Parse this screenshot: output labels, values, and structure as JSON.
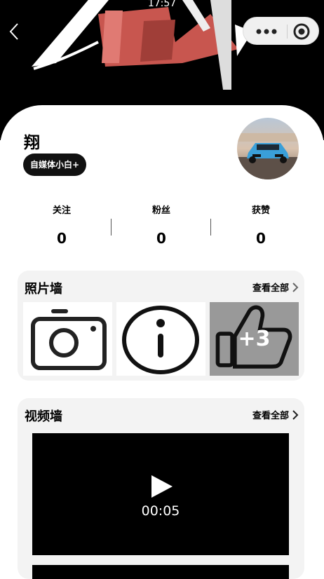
{
  "status_bar": {
    "time": "17:57"
  },
  "nav": {
    "back_icon": "chevron-left-icon",
    "more_icon": "more-dots-icon",
    "close_icon": "target-circle-icon"
  },
  "profile": {
    "name": "翔",
    "tag": "自媒体小白+"
  },
  "stats": [
    {
      "label": "关注",
      "value": "0"
    },
    {
      "label": "粉丝",
      "value": "0"
    },
    {
      "label": "获赞",
      "value": "0"
    }
  ],
  "photo_wall": {
    "title": "照片墙",
    "view_all": "查看全部",
    "items": [
      {
        "icon": "camera-icon"
      },
      {
        "icon": "info-icon"
      },
      {
        "icon": "thumbs-up-icon",
        "more_count": "+3"
      }
    ]
  },
  "video_wall": {
    "title": "视频墙",
    "view_all": "查看全部",
    "videos": [
      {
        "duration": "00:05"
      },
      {
        "duration": ""
      }
    ]
  },
  "colors": {
    "accent_red": "#d9534f",
    "panel_bg": "#f3f3f3",
    "tag_bg": "#111111"
  }
}
